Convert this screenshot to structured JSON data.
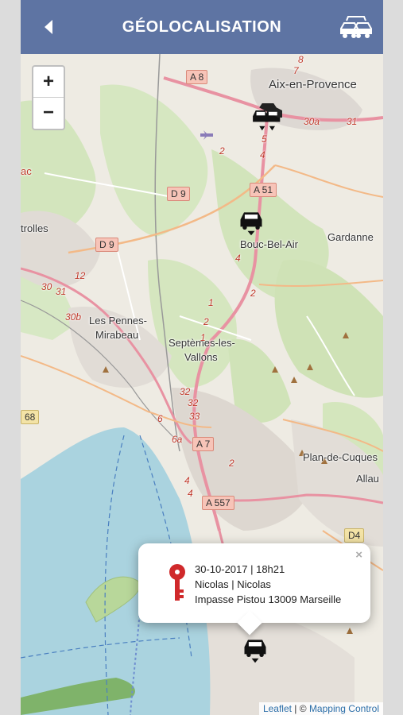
{
  "header": {
    "title": "GÉOLOCALISATION",
    "back_icon": "chevron-left-icon",
    "fleet_icon": "cars-icon"
  },
  "map": {
    "zoom_in": "+",
    "zoom_out": "−",
    "places": {
      "aix": "Aix-en-Provence",
      "bouc": "Bouc-Bel-Air",
      "gardanne": "Gardanne",
      "vitrolles": "trolles",
      "pennes_1": "Les Pennes-",
      "pennes_2": "Mirabeau",
      "septemes_1": "Septèmes-les-",
      "septemes_2": "Vallons",
      "plan": "Plan-de-Cuques",
      "allau": "Allau",
      "ac": "ac"
    },
    "roads": {
      "a8": "A 8",
      "a51": "A 51",
      "d9_top": "D 9",
      "d9_left": "D 9",
      "a7": "A 7",
      "a557": "A 557",
      "d4": "D4",
      "r68": "68"
    },
    "route_numbers": [
      "8",
      "7",
      "5",
      "4",
      "2",
      "30a",
      "31",
      "2",
      "4",
      "12",
      "30",
      "31",
      "30b",
      "1",
      "2",
      "1",
      "32",
      "32",
      "33",
      "6",
      "6a",
      "4",
      "4",
      "2"
    ],
    "attribution": {
      "leaflet": "Leaflet",
      "separator": " | © ",
      "provider": "Mapping Control"
    }
  },
  "popup": {
    "close": "×",
    "icon": "key-icon",
    "line1": "30-10-2017 | 18h21",
    "line2": "Nicolas | Nicolas",
    "line3": "Impasse Pistou 13009 Marseille"
  },
  "colors": {
    "header": "#5e74a3",
    "sea": "#aad3df",
    "forest": "#cde3b8",
    "motorway": "#e892a2",
    "key": "#d0292b"
  }
}
